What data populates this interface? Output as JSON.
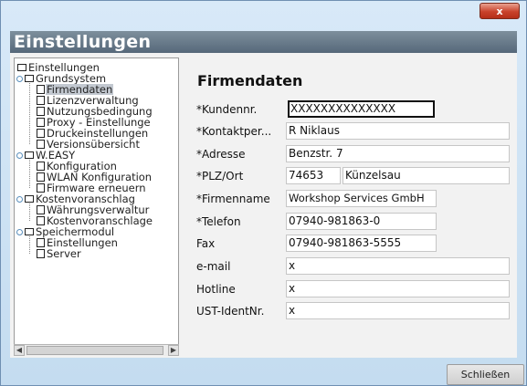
{
  "window": {
    "close_glyph": "x"
  },
  "header": {
    "title": "Einstellungen"
  },
  "tree": {
    "items": [
      {
        "label": "Einstellungen",
        "icon": "folder-icon",
        "level": 0,
        "toggle": false,
        "selected": false
      },
      {
        "label": "Grundsystem",
        "icon": "folder-icon",
        "level": 0,
        "toggle": true,
        "selected": false
      },
      {
        "label": "Firmendaten",
        "icon": "document-icon",
        "level": 1,
        "toggle": false,
        "selected": true
      },
      {
        "label": "Lizenzverwaltung",
        "icon": "document-icon",
        "level": 1,
        "toggle": false,
        "selected": false
      },
      {
        "label": "Nutzungsbedingung",
        "icon": "document-icon",
        "level": 1,
        "toggle": false,
        "selected": false
      },
      {
        "label": "Proxy - Einstellunge",
        "icon": "document-icon",
        "level": 1,
        "toggle": false,
        "selected": false
      },
      {
        "label": "Druckeinstellungen",
        "icon": "document-icon",
        "level": 1,
        "toggle": false,
        "selected": false
      },
      {
        "label": "Versionsübersicht",
        "icon": "document-icon",
        "level": 1,
        "toggle": false,
        "selected": false
      },
      {
        "label": "W.EASY",
        "icon": "folder-icon",
        "level": 0,
        "toggle": true,
        "selected": false
      },
      {
        "label": "Konfiguration",
        "icon": "document-icon",
        "level": 1,
        "toggle": false,
        "selected": false
      },
      {
        "label": "WLAN Konfiguration",
        "icon": "document-icon",
        "level": 1,
        "toggle": false,
        "selected": false
      },
      {
        "label": "Firmware erneuern",
        "icon": "document-icon",
        "level": 1,
        "toggle": false,
        "selected": false
      },
      {
        "label": "Kostenvoranschlag",
        "icon": "folder-icon",
        "level": 0,
        "toggle": true,
        "selected": false
      },
      {
        "label": "Währungsverwaltur",
        "icon": "document-icon",
        "level": 1,
        "toggle": false,
        "selected": false
      },
      {
        "label": "Kostenvoranschlage",
        "icon": "document-icon",
        "level": 1,
        "toggle": false,
        "selected": false
      },
      {
        "label": "Speichermodul",
        "icon": "folder-icon",
        "level": 0,
        "toggle": true,
        "selected": false
      },
      {
        "label": "Einstellungen",
        "icon": "document-icon",
        "level": 1,
        "toggle": false,
        "selected": false
      },
      {
        "label": "Server",
        "icon": "document-icon",
        "level": 1,
        "toggle": false,
        "selected": false
      }
    ],
    "scroll_left": "◀",
    "scroll_right": "▶"
  },
  "form": {
    "title": "Firmendaten",
    "fields": {
      "kundennr": {
        "label": "*Kundennr.",
        "value": "XXXXXXXXXXXXXX"
      },
      "kontaktperson": {
        "label": "*Kontaktper...",
        "value": "R Niklaus"
      },
      "adresse": {
        "label": "*Adresse",
        "value": "Benzstr. 7"
      },
      "plz_ort": {
        "label": "*PLZ/Ort",
        "plz": "74653",
        "ort": "Künzelsau"
      },
      "firmenname": {
        "label": "*Firmenname",
        "value": "Workshop Services GmbH"
      },
      "telefon": {
        "label": "*Telefon",
        "value": "07940-981863-0"
      },
      "fax": {
        "label": "Fax",
        "value": "07940-981863-5555"
      },
      "email": {
        "label": "e-mail",
        "value": "x"
      },
      "hotline": {
        "label": "Hotline",
        "value": "x"
      },
      "ust_ident": {
        "label": "UST-IdentNr.",
        "value": "x"
      }
    }
  },
  "footer": {
    "close_label": "Schließen"
  },
  "colors": {
    "window_bg": "#cfe2f3",
    "header_bg": "#5e7080",
    "close_red": "#c9422b",
    "selection": "#c2c8d0"
  }
}
